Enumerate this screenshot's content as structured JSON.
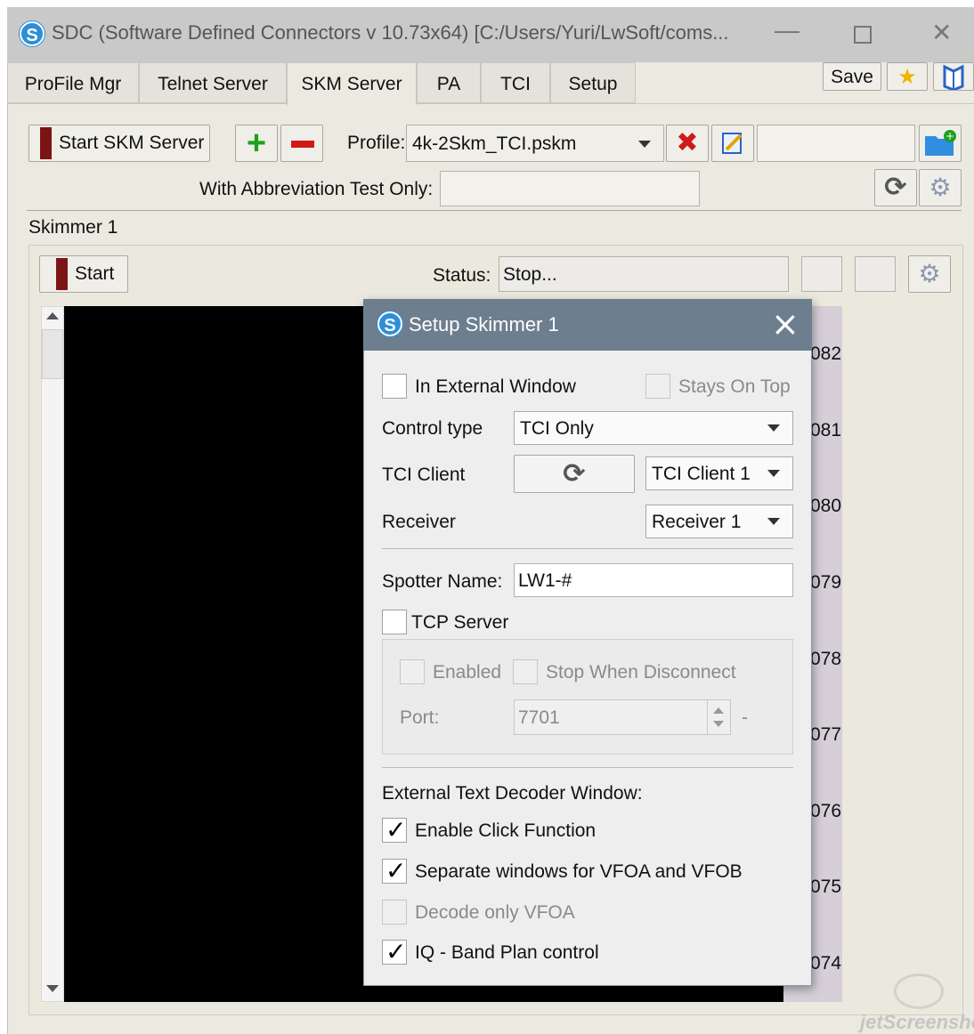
{
  "window": {
    "title": "SDC (Software Defined Connectors v 10.73x64) [C:/Users/Yuri/LwSoft/coms..."
  },
  "tabs": [
    {
      "label": "ProFile Mgr"
    },
    {
      "label": "Telnet Server"
    },
    {
      "label": "SKM Server"
    },
    {
      "label": "PA"
    },
    {
      "label": "TCI"
    },
    {
      "label": "Setup"
    }
  ],
  "active_tab": "SKM Server",
  "toolbar": {
    "save_label": "Save"
  },
  "skm": {
    "start_server_label": "Start SKM Server",
    "add_symbol": "+",
    "profile_label": "Profile:",
    "profile_value": "4k-2Skm_TCI.pskm",
    "abbrev_label": "With Abbreviation Test Only:",
    "abbrev_value": ""
  },
  "skimmer": {
    "group_title": "Skimmer 1",
    "start_label": "Start",
    "status_label": "Status:",
    "status_value": "Stop...",
    "freq_labels": [
      "082",
      "081",
      "080",
      "079",
      "078",
      "077",
      "076",
      "075",
      "074"
    ]
  },
  "dialog": {
    "title": "Setup Skimmer 1",
    "close_symbol": "×",
    "external_window_label": "In External Window",
    "stays_on_top_label": "Stays On Top",
    "control_type_label": "Control type",
    "control_type_value": "TCI Only",
    "tci_client_label": "TCI Client",
    "tci_client_value": "TCI Client 1",
    "receiver_label": "Receiver",
    "receiver_value": "Receiver 1",
    "spotter_name_label": "Spotter Name:",
    "spotter_name_value": "LW1-#",
    "tcp_server_label": "TCP Server",
    "enabled_label": "Enabled",
    "stop_when_disconnect_label": "Stop When Disconnect",
    "port_label": "Port:",
    "port_value": "7701",
    "port_suffix": "-",
    "decoder_heading": "External Text Decoder Window:",
    "options": [
      {
        "label": "Enable Click Function",
        "checked": true,
        "enabled": true
      },
      {
        "label": "Separate windows for VFOA and VFOB",
        "checked": true,
        "enabled": true
      },
      {
        "label": "Decode only VFOA",
        "checked": false,
        "enabled": false
      },
      {
        "label": "IQ - Band Plan control",
        "checked": true,
        "enabled": true
      }
    ]
  },
  "watermark": {
    "text": "jetScreenshot"
  },
  "colors": {
    "titlebar": "#c9c9c9",
    "dialog_header": "#6d7e8f",
    "start_red": "#7d1414",
    "plus_green": "#1ea01e",
    "minus_red": "#d01a1a"
  }
}
